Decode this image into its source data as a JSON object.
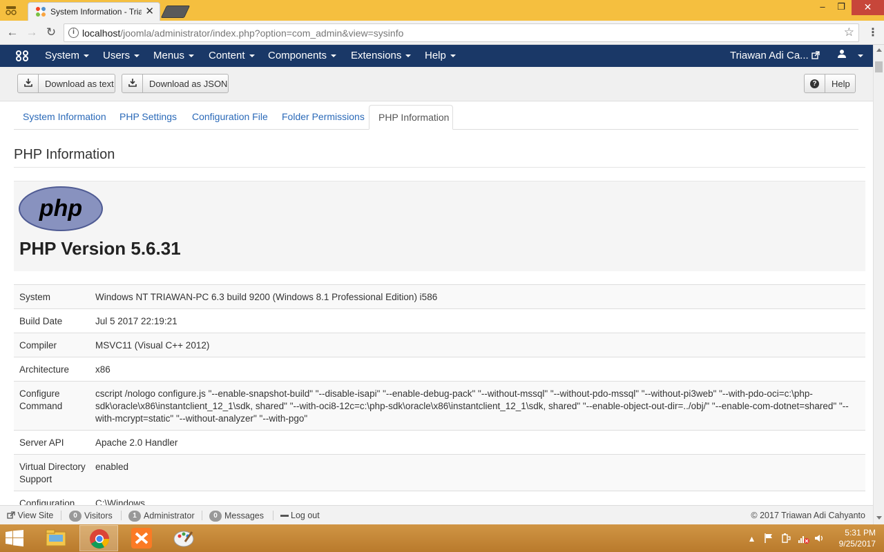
{
  "browser": {
    "tab_title": "System Information - Tria",
    "tab_close": "✕",
    "url_host": "localhost",
    "url_path": "/joomla/administrator/index.php?option=com_admin&view=sysinfo",
    "window_minimize": "–",
    "window_maximize": "❐",
    "window_close": "✕"
  },
  "nav": {
    "menus": [
      "System",
      "Users",
      "Menus",
      "Content",
      "Components",
      "Extensions",
      "Help"
    ],
    "user_name": "Triawan Adi Ca..."
  },
  "toolbar": {
    "download_text": "Download as text",
    "download_json": "Download as JSON",
    "help": "Help"
  },
  "tabs": {
    "items": [
      "System Information",
      "PHP Settings",
      "Configuration File",
      "Folder Permissions"
    ],
    "active": "PHP Information"
  },
  "page": {
    "heading": "PHP Information",
    "php_logo_text": "php",
    "php_version": "PHP Version 5.6.31"
  },
  "info_rows": [
    {
      "key": "System",
      "value": "Windows NT TRIAWAN-PC 6.3 build 9200 (Windows 8.1 Professional Edition) i586"
    },
    {
      "key": "Build Date",
      "value": "Jul 5 2017 22:19:21"
    },
    {
      "key": "Compiler",
      "value": "MSVC11 (Visual C++ 2012)"
    },
    {
      "key": "Architecture",
      "value": "x86"
    },
    {
      "key": "Configure Command",
      "value": "cscript /nologo configure.js \"--enable-snapshot-build\" \"--disable-isapi\" \"--enable-debug-pack\" \"--without-mssql\" \"--without-pdo-mssql\" \"--without-pi3web\" \"--with-pdo-oci=c:\\php-sdk\\oracle\\x86\\instantclient_12_1\\sdk, shared\" \"--with-oci8-12c=c:\\php-sdk\\oracle\\x86\\instantclient_12_1\\sdk, shared\" \"--enable-object-out-dir=../obj/\" \"--enable-com-dotnet=shared\" \"--with-mcrypt=static\" \"--without-analyzer\" \"--with-pgo\""
    },
    {
      "key": "Server API",
      "value": "Apache 2.0 Handler"
    },
    {
      "key": "Virtual Directory Support",
      "value": "enabled"
    },
    {
      "key": "Configuration",
      "value": "C:\\Windows"
    }
  ],
  "status": {
    "view_site": "View Site",
    "visitors_count": "0",
    "visitors": "Visitors",
    "admin_count": "1",
    "administrator": "Administrator",
    "messages_count": "0",
    "messages": "Messages",
    "logout": "Log out",
    "copyright": "© 2017 Triawan Adi Cahyanto"
  },
  "taskbar": {
    "time": "5:31 PM",
    "date": "9/25/2017"
  },
  "colors": {
    "joomla_nav": "#1a3867",
    "link": "#2a69b8",
    "taskbar": "#c8893a",
    "chrome_frame": "#f5bf3f",
    "php_logo": "#8892bf"
  }
}
